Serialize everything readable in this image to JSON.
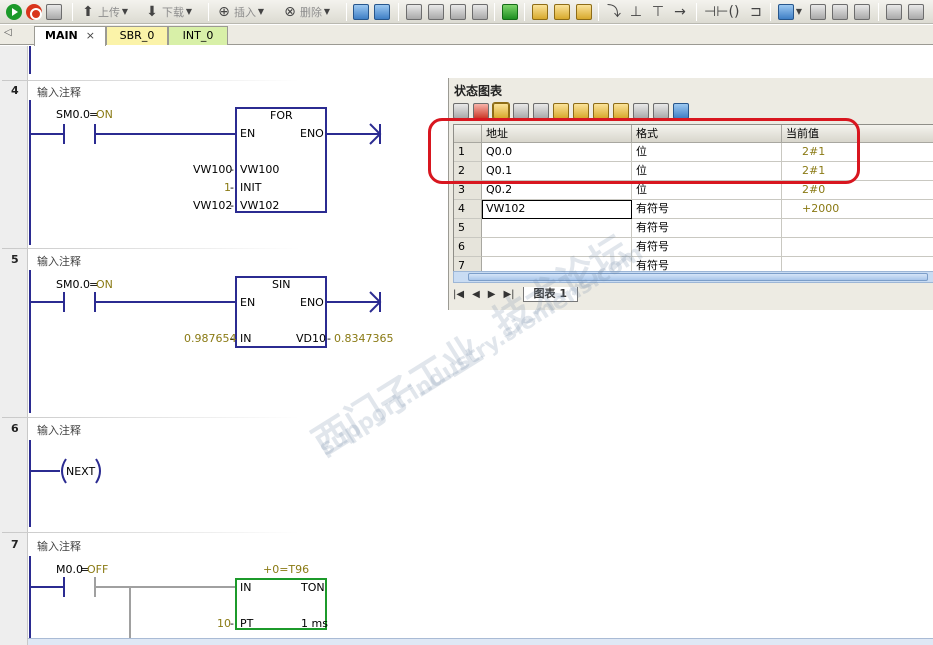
{
  "toolbar": {
    "upload_label": "上传",
    "download_label": "下载",
    "insert_label": "插入",
    "delete_label": "删除"
  },
  "tabs": [
    {
      "label": "MAIN"
    },
    {
      "label": "SBR_0"
    },
    {
      "label": "INT_0"
    }
  ],
  "tab_close_glyph": "×",
  "networks": [
    {
      "number": "4",
      "comment": "输入注释"
    },
    {
      "number": "5",
      "comment": "输入注释"
    },
    {
      "number": "6",
      "comment": "输入注释"
    },
    {
      "number": "7",
      "comment": "输入注释"
    }
  ],
  "ladder": {
    "n4": {
      "contact": "SM0.0",
      "contact_state": "ON",
      "box_name": "FOR",
      "en": "EN",
      "eno": "ENO",
      "in1_label": "VW100",
      "in1_value": "VW100",
      "in2_label": "INIT",
      "in2_value": "1",
      "in3_label": "VW102",
      "in3_value": "VW102"
    },
    "n5": {
      "contact": "SM0.0",
      "contact_state": "ON",
      "box_name": "SIN",
      "en": "EN",
      "eno": "ENO",
      "in_label": "IN",
      "in_value": "0.987654",
      "out_label": "VD10",
      "out_value": "0.8347365"
    },
    "n6": {
      "coil": "NEXT"
    },
    "n7": {
      "contact": "M0.0",
      "contact_state": "OFF",
      "box_name": "TON",
      "box_status": "+0=T96",
      "in_label": "IN",
      "pt_label": "PT",
      "pt_value": "10",
      "resolution": "1 ms"
    },
    "equals": "=",
    "dash": "-"
  },
  "status_chart": {
    "title": "状态图表",
    "columns": [
      "地址",
      "格式",
      "当前值"
    ],
    "rows": [
      {
        "n": "1",
        "address": "Q0.0",
        "format": "位",
        "value": "2#1"
      },
      {
        "n": "2",
        "address": "Q0.1",
        "format": "位",
        "value": "2#1"
      },
      {
        "n": "3",
        "address": "Q0.2",
        "format": "位",
        "value": "2#0"
      },
      {
        "n": "4",
        "address": "VW102",
        "format": "有符号",
        "value": "+2000"
      },
      {
        "n": "5",
        "address": "",
        "format": "有符号",
        "value": ""
      },
      {
        "n": "6",
        "address": "",
        "format": "有符号",
        "value": ""
      },
      {
        "n": "7",
        "address": "",
        "format": "有符号",
        "value": ""
      }
    ],
    "sheet_tab": "图表 1"
  },
  "watermark": {
    "line1": "西门子工业",
    "line2": "技术论坛",
    "line3": "support.industry.siemens.com"
  },
  "colors": {
    "ladder_wire": "#2b2b91",
    "status_value": "#8a7a14",
    "highlight": "#d8161f",
    "timer_box_border": "#1c9a2a"
  }
}
